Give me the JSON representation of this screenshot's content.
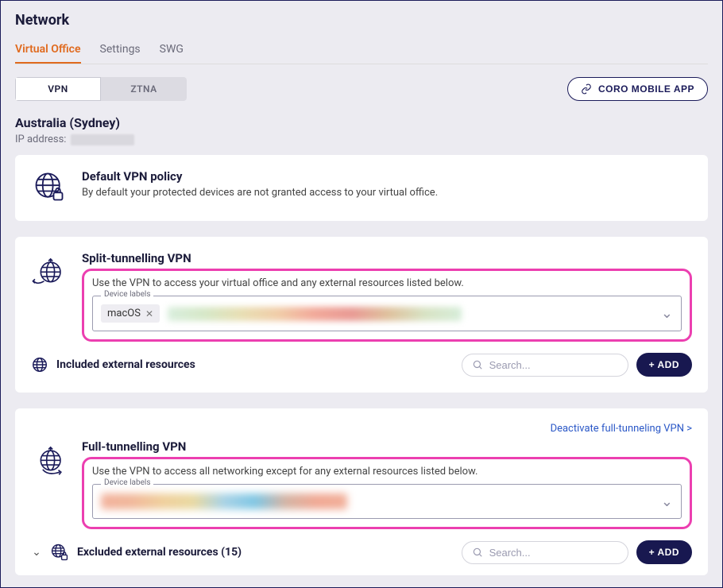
{
  "page": {
    "title": "Network"
  },
  "tabs": {
    "virtual_office": "Virtual Office",
    "settings": "Settings",
    "swg": "SWG"
  },
  "segments": {
    "vpn": "VPN",
    "ztna": "ZTNA"
  },
  "mobile_app_btn": "CORO MOBILE APP",
  "region": {
    "title": "Australia (Sydney)",
    "ip_label": "IP address:"
  },
  "default_policy": {
    "title": "Default VPN policy",
    "desc": "By default your protected devices are not granted access to your virtual office."
  },
  "split": {
    "title": "Split-tunnelling VPN",
    "desc": "Use the VPN to access your virtual office and any external resources listed below.",
    "legend": "Device labels",
    "chip": "macOS"
  },
  "included": {
    "title": "Included external resources",
    "search_placeholder": "Search...",
    "add": "+ ADD"
  },
  "full": {
    "deactivate": "Deactivate full-tunneling VPN >",
    "title": "Full-tunnelling VPN",
    "desc": "Use the VPN to access all networking except for any external resources listed below.",
    "legend": "Device labels"
  },
  "excluded": {
    "title": "Excluded external resources (15)",
    "search_placeholder": "Search...",
    "add": "+ ADD"
  }
}
